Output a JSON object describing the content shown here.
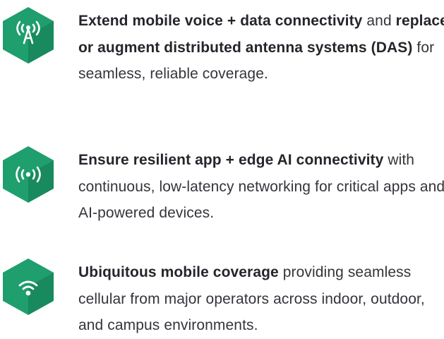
{
  "colors": {
    "hex_light": "#1f9e6e",
    "hex_dark": "#137a52",
    "icon": "#ffffff",
    "text": "#2b2d33"
  },
  "features": [
    {
      "icon": "antenna-tower-icon",
      "bold": "Extend mobile voice + data connectivity",
      "rest": " and replace or augment distributed antenna systems (DAS) for seamless, reliable coverage.",
      "bold2": "replace or augment distributed antenna systems (DAS)",
      "rest_a": " and ",
      "rest_b": " for seamless, reliable coverage."
    },
    {
      "icon": "broadcast-signal-icon",
      "bold": "Ensure resilient app + edge AI connectivity",
      "rest": " with continuous, low-latency networking for critical apps and AI-powered devices."
    },
    {
      "icon": "wifi-icon",
      "bold": "Ubiquitous mobile coverage",
      "rest": " providing seamless cellular from major operators across indoor, outdoor, and campus environments."
    }
  ]
}
